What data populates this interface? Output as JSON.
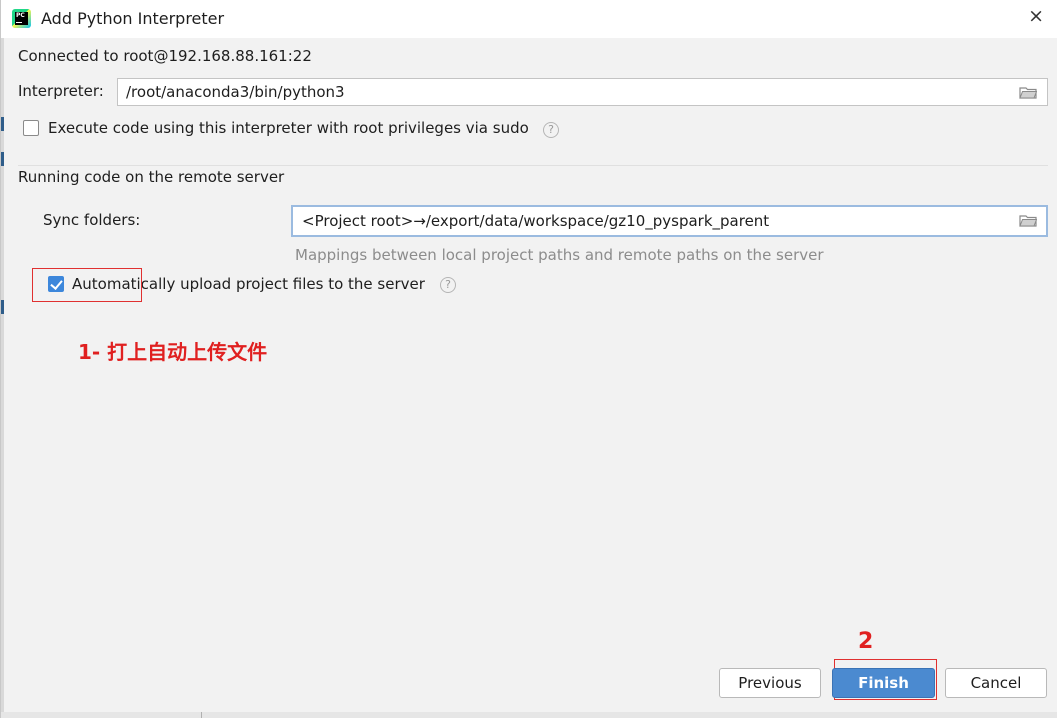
{
  "window": {
    "title": "Add Python Interpreter",
    "app_icon": "pycharm-logo",
    "app_icon_text": "PC",
    "close_glyph": "×"
  },
  "connection": {
    "text": "Connected to root@192.168.88.161:22"
  },
  "interpreter": {
    "label": "Interpreter:",
    "value": "/root/anaconda3/bin/python3"
  },
  "sudo_option": {
    "label": "Execute code using this interpreter with root privileges via sudo",
    "checked": false
  },
  "remote_section": {
    "heading": "Running code on the remote server",
    "sync_label": "Sync folders:",
    "sync_value": "<Project root>→/export/data/workspace/gz10_pyspark_parent",
    "sync_hint": "Mappings between local project paths and remote paths on the server",
    "auto_upload_label": "Automatically upload project files to the server",
    "auto_upload_checked": true
  },
  "annotations": {
    "step1": "1- 打上自动上传文件",
    "step2": "2",
    "color": "#e02020"
  },
  "buttons": {
    "previous": "Previous",
    "finish": "Finish",
    "cancel": "Cancel"
  },
  "icons": {
    "help": "?",
    "folder": "folder-icon"
  },
  "colors": {
    "accent": "#4b8ad0",
    "checkbox_checked": "#3d87db",
    "annotation_box": "#e03030"
  }
}
